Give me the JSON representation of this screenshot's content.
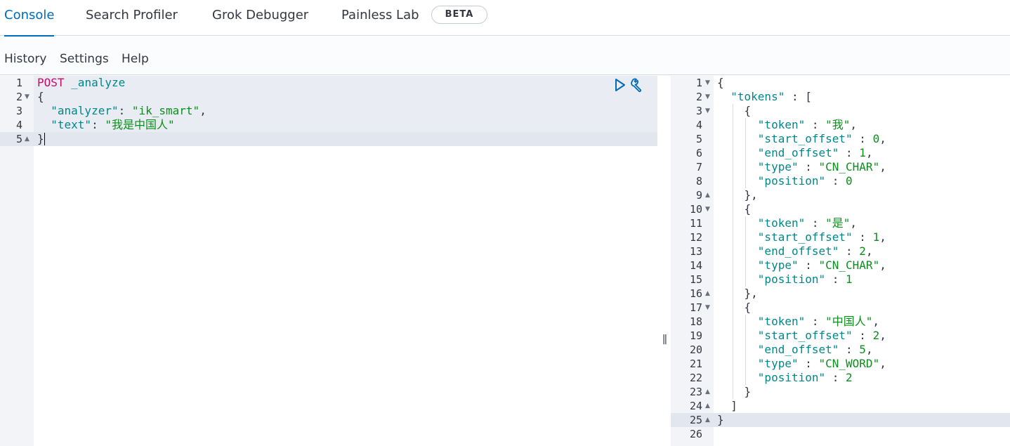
{
  "tabs": [
    {
      "label": "Console",
      "active": true
    },
    {
      "label": "Search Profiler",
      "active": false
    },
    {
      "label": "Grok Debugger",
      "active": false
    },
    {
      "label": "Painless Lab",
      "active": false
    }
  ],
  "beta_badge": "BETA",
  "menu": [
    "History",
    "Settings",
    "Help"
  ],
  "request_editor": {
    "active_line": 5,
    "lines": [
      {
        "n": "1",
        "fold": "",
        "tokens": [
          {
            "t": "method",
            "v": "POST"
          },
          {
            "t": "punc",
            "v": " "
          },
          {
            "t": "url",
            "v": "_analyze"
          }
        ]
      },
      {
        "n": "2",
        "fold": "down",
        "tokens": [
          {
            "t": "punc",
            "v": "{"
          }
        ]
      },
      {
        "n": "3",
        "fold": "",
        "tokens": [
          {
            "t": "punc",
            "v": "  "
          },
          {
            "t": "key",
            "v": "\"analyzer\""
          },
          {
            "t": "punc",
            "v": ": "
          },
          {
            "t": "str",
            "v": "\"ik_smart\""
          },
          {
            "t": "punc",
            "v": ","
          }
        ]
      },
      {
        "n": "4",
        "fold": "",
        "tokens": [
          {
            "t": "punc",
            "v": "  "
          },
          {
            "t": "key",
            "v": "\"text\""
          },
          {
            "t": "punc",
            "v": ": "
          },
          {
            "t": "str",
            "v": "\"我是中国人\""
          }
        ]
      },
      {
        "n": "5",
        "fold": "up",
        "tokens": [
          {
            "t": "punc",
            "v": "}"
          }
        ]
      }
    ]
  },
  "request_actions": [
    {
      "icon": "play-icon",
      "label": "Click to send request"
    },
    {
      "icon": "wrench-icon",
      "label": "Request options"
    }
  ],
  "resizer_glyph": "||",
  "response_editor": {
    "active_line": 25,
    "lines": [
      {
        "n": "1",
        "fold": "down",
        "tokens": [
          {
            "t": "punc",
            "v": "{"
          }
        ]
      },
      {
        "n": "2",
        "fold": "down",
        "tokens": [
          {
            "t": "punc",
            "v": "  "
          },
          {
            "t": "key",
            "v": "\"tokens\""
          },
          {
            "t": "punc",
            "v": " : ["
          }
        ]
      },
      {
        "n": "3",
        "fold": "down",
        "tokens": [
          {
            "t": "punc",
            "v": "    {"
          }
        ]
      },
      {
        "n": "4",
        "fold": "",
        "tokens": [
          {
            "t": "punc",
            "v": "      "
          },
          {
            "t": "key",
            "v": "\"token\""
          },
          {
            "t": "punc",
            "v": " : "
          },
          {
            "t": "str",
            "v": "\"我\""
          },
          {
            "t": "punc",
            "v": ","
          }
        ]
      },
      {
        "n": "5",
        "fold": "",
        "tokens": [
          {
            "t": "punc",
            "v": "      "
          },
          {
            "t": "key",
            "v": "\"start_offset\""
          },
          {
            "t": "punc",
            "v": " : "
          },
          {
            "t": "num",
            "v": "0"
          },
          {
            "t": "punc",
            "v": ","
          }
        ]
      },
      {
        "n": "6",
        "fold": "",
        "tokens": [
          {
            "t": "punc",
            "v": "      "
          },
          {
            "t": "key",
            "v": "\"end_offset\""
          },
          {
            "t": "punc",
            "v": " : "
          },
          {
            "t": "num",
            "v": "1"
          },
          {
            "t": "punc",
            "v": ","
          }
        ]
      },
      {
        "n": "7",
        "fold": "",
        "tokens": [
          {
            "t": "punc",
            "v": "      "
          },
          {
            "t": "key",
            "v": "\"type\""
          },
          {
            "t": "punc",
            "v": " : "
          },
          {
            "t": "str",
            "v": "\"CN_CHAR\""
          },
          {
            "t": "punc",
            "v": ","
          }
        ]
      },
      {
        "n": "8",
        "fold": "",
        "tokens": [
          {
            "t": "punc",
            "v": "      "
          },
          {
            "t": "key",
            "v": "\"position\""
          },
          {
            "t": "punc",
            "v": " : "
          },
          {
            "t": "num",
            "v": "0"
          }
        ]
      },
      {
        "n": "9",
        "fold": "up",
        "tokens": [
          {
            "t": "punc",
            "v": "    },"
          }
        ]
      },
      {
        "n": "10",
        "fold": "down",
        "tokens": [
          {
            "t": "punc",
            "v": "    {"
          }
        ]
      },
      {
        "n": "11",
        "fold": "",
        "tokens": [
          {
            "t": "punc",
            "v": "      "
          },
          {
            "t": "key",
            "v": "\"token\""
          },
          {
            "t": "punc",
            "v": " : "
          },
          {
            "t": "str",
            "v": "\"是\""
          },
          {
            "t": "punc",
            "v": ","
          }
        ]
      },
      {
        "n": "12",
        "fold": "",
        "tokens": [
          {
            "t": "punc",
            "v": "      "
          },
          {
            "t": "key",
            "v": "\"start_offset\""
          },
          {
            "t": "punc",
            "v": " : "
          },
          {
            "t": "num",
            "v": "1"
          },
          {
            "t": "punc",
            "v": ","
          }
        ]
      },
      {
        "n": "13",
        "fold": "",
        "tokens": [
          {
            "t": "punc",
            "v": "      "
          },
          {
            "t": "key",
            "v": "\"end_offset\""
          },
          {
            "t": "punc",
            "v": " : "
          },
          {
            "t": "num",
            "v": "2"
          },
          {
            "t": "punc",
            "v": ","
          }
        ]
      },
      {
        "n": "14",
        "fold": "",
        "tokens": [
          {
            "t": "punc",
            "v": "      "
          },
          {
            "t": "key",
            "v": "\"type\""
          },
          {
            "t": "punc",
            "v": " : "
          },
          {
            "t": "str",
            "v": "\"CN_CHAR\""
          },
          {
            "t": "punc",
            "v": ","
          }
        ]
      },
      {
        "n": "15",
        "fold": "",
        "tokens": [
          {
            "t": "punc",
            "v": "      "
          },
          {
            "t": "key",
            "v": "\"position\""
          },
          {
            "t": "punc",
            "v": " : "
          },
          {
            "t": "num",
            "v": "1"
          }
        ]
      },
      {
        "n": "16",
        "fold": "up",
        "tokens": [
          {
            "t": "punc",
            "v": "    },"
          }
        ]
      },
      {
        "n": "17",
        "fold": "down",
        "tokens": [
          {
            "t": "punc",
            "v": "    {"
          }
        ]
      },
      {
        "n": "18",
        "fold": "",
        "tokens": [
          {
            "t": "punc",
            "v": "      "
          },
          {
            "t": "key",
            "v": "\"token\""
          },
          {
            "t": "punc",
            "v": " : "
          },
          {
            "t": "str",
            "v": "\"中国人\""
          },
          {
            "t": "punc",
            "v": ","
          }
        ]
      },
      {
        "n": "19",
        "fold": "",
        "tokens": [
          {
            "t": "punc",
            "v": "      "
          },
          {
            "t": "key",
            "v": "\"start_offset\""
          },
          {
            "t": "punc",
            "v": " : "
          },
          {
            "t": "num",
            "v": "2"
          },
          {
            "t": "punc",
            "v": ","
          }
        ]
      },
      {
        "n": "20",
        "fold": "",
        "tokens": [
          {
            "t": "punc",
            "v": "      "
          },
          {
            "t": "key",
            "v": "\"end_offset\""
          },
          {
            "t": "punc",
            "v": " : "
          },
          {
            "t": "num",
            "v": "5"
          },
          {
            "t": "punc",
            "v": ","
          }
        ]
      },
      {
        "n": "21",
        "fold": "",
        "tokens": [
          {
            "t": "punc",
            "v": "      "
          },
          {
            "t": "key",
            "v": "\"type\""
          },
          {
            "t": "punc",
            "v": " : "
          },
          {
            "t": "str",
            "v": "\"CN_WORD\""
          },
          {
            "t": "punc",
            "v": ","
          }
        ]
      },
      {
        "n": "22",
        "fold": "",
        "tokens": [
          {
            "t": "punc",
            "v": "      "
          },
          {
            "t": "key",
            "v": "\"position\""
          },
          {
            "t": "punc",
            "v": " : "
          },
          {
            "t": "num",
            "v": "2"
          }
        ]
      },
      {
        "n": "23",
        "fold": "up",
        "tokens": [
          {
            "t": "punc",
            "v": "    }"
          }
        ]
      },
      {
        "n": "24",
        "fold": "up",
        "tokens": [
          {
            "t": "punc",
            "v": "  ]"
          }
        ]
      },
      {
        "n": "25",
        "fold": "up",
        "tokens": [
          {
            "t": "punc",
            "v": "}"
          }
        ]
      },
      {
        "n": "26",
        "fold": "",
        "tokens": []
      }
    ]
  },
  "colors": {
    "accent": "#006bb8",
    "method": "#c80a68",
    "key": "#00878a",
    "string": "#0b8f1c"
  }
}
